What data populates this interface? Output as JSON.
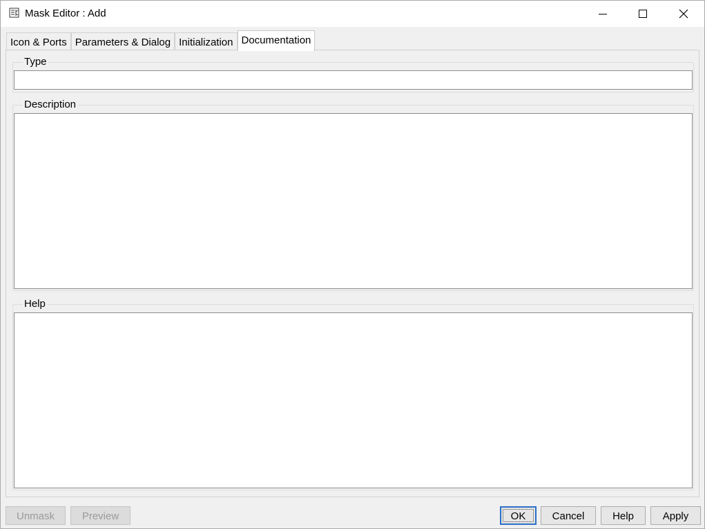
{
  "window": {
    "title": "Mask Editor : Add",
    "app_icon": "mask-editor-icon",
    "controls": [
      "minimize-icon",
      "maximize-icon",
      "close-icon"
    ]
  },
  "tabs": [
    {
      "label": "Icon & Ports",
      "active": false
    },
    {
      "label": "Parameters & Dialog",
      "active": false
    },
    {
      "label": "Initialization",
      "active": false
    },
    {
      "label": "Documentation",
      "active": true
    }
  ],
  "documentation": {
    "type_label": "Type",
    "type_value": "",
    "description_label": "Description",
    "description_value": "",
    "help_label": "Help",
    "help_value": ""
  },
  "buttons": {
    "unmask": "Unmask",
    "preview": "Preview",
    "ok": "OK",
    "cancel": "Cancel",
    "help": "Help",
    "apply": "Apply"
  },
  "colors": {
    "background": "#f0f0f0",
    "titlebar": "#ffffff",
    "default_button_border": "#2a6fc9",
    "disabled_text": "#9a9a9a"
  }
}
